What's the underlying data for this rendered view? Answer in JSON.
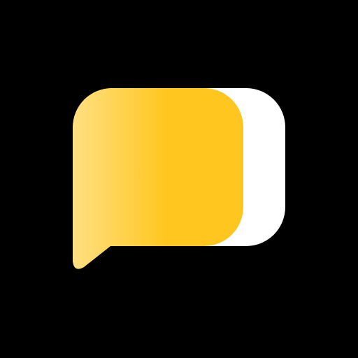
{
  "app": {
    "icon_name": "chat-bubble-logo-icon"
  },
  "colors": {
    "background": "#000000",
    "bubble_back": "#FFFFFF",
    "bubble_front_light": "#FFE082",
    "bubble_front_dark": "#FFC61F"
  }
}
